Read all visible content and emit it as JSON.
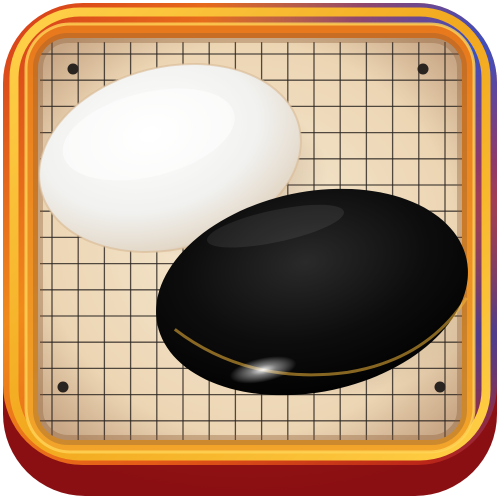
{
  "icon": {
    "subject": "go-game-app-icon",
    "frame_colors": {
      "gold": "#f2b01e",
      "orange": "#e5601a",
      "red": "#c8201e",
      "purple": "#6a2c8c",
      "blue": "#2c4fd0"
    },
    "board": {
      "background": "#efdcbf",
      "line_color": "#2a2420",
      "star_points": 4
    },
    "stones": [
      {
        "name": "white-stone",
        "color": "#f4f4f2"
      },
      {
        "name": "black-stone",
        "color": "#0a0a0a"
      }
    ]
  }
}
